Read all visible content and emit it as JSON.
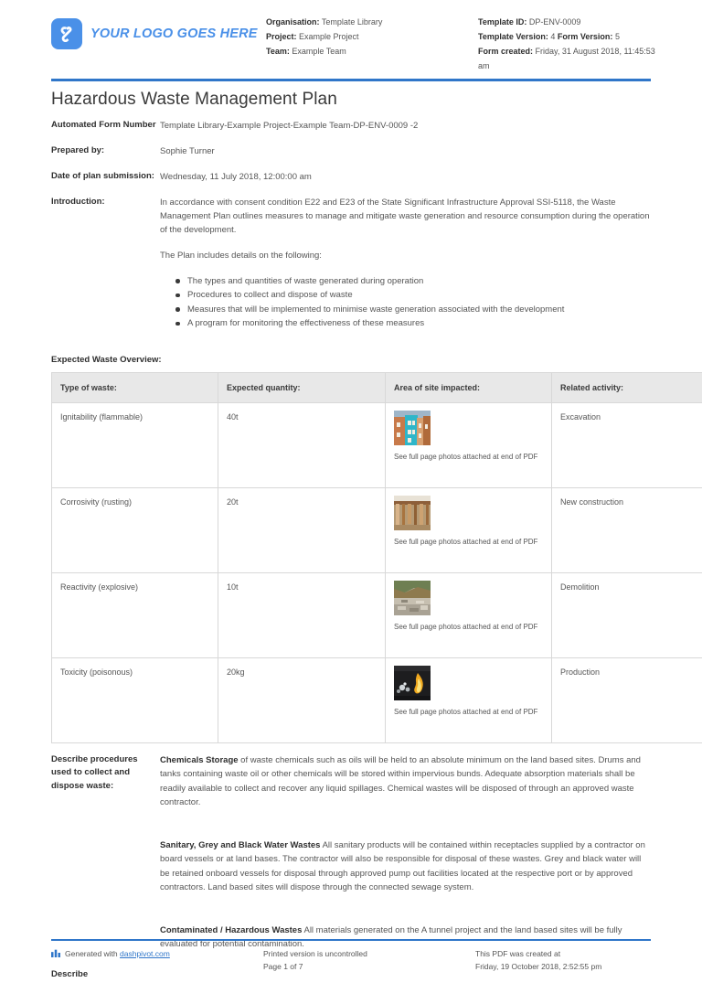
{
  "header": {
    "logo_text": "YOUR LOGO GOES HERE",
    "logo_icon": "dashpivot-logo-icon",
    "accent_color": "#2f76c9",
    "logo_color": "#4a90e8",
    "meta_left": [
      {
        "label": "Organisation:",
        "value": "Template Library"
      },
      {
        "label": "Project:",
        "value": "Example Project"
      },
      {
        "label": "Team:",
        "value": "Example Team"
      }
    ],
    "meta_right": [
      {
        "label": "Template ID:",
        "value": "DP-ENV-0009"
      },
      {
        "label": "Template Version:",
        "value": "4",
        "label2": "Form Version:",
        "value2": "5"
      },
      {
        "label": "Form created:",
        "value": "Friday, 31 August 2018, 11:45:53 am"
      }
    ]
  },
  "title": "Hazardous Waste Management Plan",
  "fields": {
    "form_number_label": "Automated Form Number",
    "form_number_value": "Template Library-Example Project-Example Team-DP-ENV-0009   -2",
    "prepared_by_label": "Prepared by:",
    "prepared_by_value": "Sophie Turner",
    "date_label": "Date of plan submission:",
    "date_value": "Wednesday, 11 July 2018, 12:00:00 am",
    "introduction_label": "Introduction:",
    "introduction_p1": "In accordance with consent condition E22 and E23 of the State Significant Infrastructure Approval SSI-5118, the Waste Management Plan outlines measures to manage and mitigate waste generation and resource consumption during the operation of the development.",
    "introduction_p2": "The Plan includes details on the following:",
    "introduction_bullets": [
      "The types and quantities of waste generated during operation",
      "Procedures to collect and dispose of waste",
      "Measures that will be implemented to minimise waste generation associated with the development",
      "A program for monitoring the effectiveness of these measures"
    ]
  },
  "table": {
    "heading": "Expected Waste Overview:",
    "columns": [
      "Type of waste:",
      "Expected quantity:",
      "Area of site impacted:",
      "Related activity:"
    ],
    "photo_caption": "See full page photos attached at end of PDF",
    "rows": [
      {
        "type": "Ignitability (flammable)",
        "quantity": "40t",
        "photo": "colourful-buildings-photo",
        "activity": "Excavation"
      },
      {
        "type": "Corrosivity (rusting)",
        "quantity": "20t",
        "photo": "rusting-timber-photo",
        "activity": "New construction"
      },
      {
        "type": "Reactivity (explosive)",
        "quantity": "10t",
        "photo": "demolition-rubble-photo",
        "activity": "Demolition"
      },
      {
        "type": "Toxicity (poisonous)",
        "quantity": "20kg",
        "photo": "flame-production-photo",
        "activity": "Production"
      }
    ]
  },
  "procedures": {
    "label": "Describe procedures used to collect and dispose waste:",
    "paragraphs": [
      {
        "heading": "Chemicals Storage",
        "text": " of waste chemicals such as oils will be held to an absolute minimum on the land based sites. Drums and tanks containing waste oil or other chemicals will be stored within impervious bunds. Adequate absorption materials shall be readily available to collect and recover any liquid spillages. Chemical wastes will be disposed of through an approved waste contractor."
      },
      {
        "heading": "Sanitary, Grey and Black Water Wastes",
        "text": " All sanitary products will be contained within receptacles supplied by a contractor on board vessels or at land bases. The contractor will also be responsible for disposal of these wastes. Grey and black water will be retained onboard vessels for disposal through approved pump out facilities located at the respective port or by approved contractors. Land based sites will dispose through the connected sewage system."
      },
      {
        "heading": "Contaminated / Hazardous Wastes",
        "text": " All materials generated on the A tunnel project and the land based sites will be fully evaluated for potential contamination."
      }
    ],
    "tail_label": "Describe"
  },
  "footer": {
    "generated_prefix": "Generated with ",
    "generated_link": "dashpivot.com",
    "printed_line1": "Printed version is uncontrolled",
    "printed_line2": "Page 1 of 7",
    "created_line1": "This PDF was created at",
    "created_line2": "Friday, 19 October 2018, 2:52:55 pm",
    "chart_icon": "bar-chart-icon"
  }
}
